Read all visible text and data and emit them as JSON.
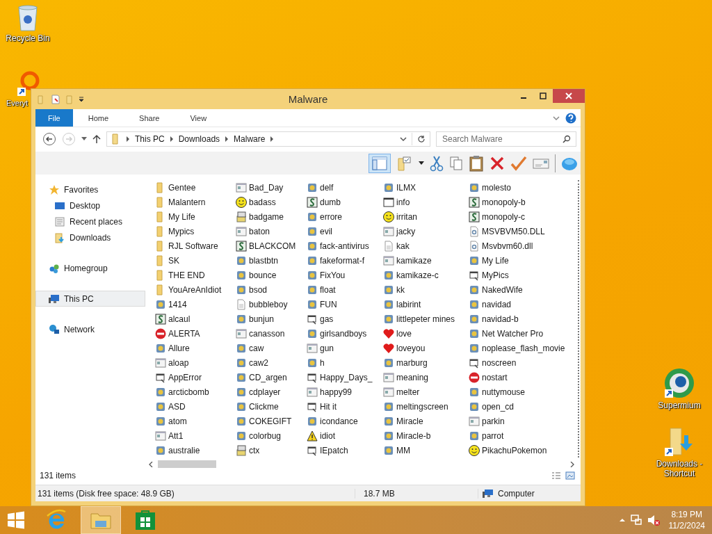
{
  "desktop_icons": [
    {
      "label": "Recycle Bin",
      "kind": "bin"
    },
    {
      "label": "Everyt",
      "kind": "search"
    }
  ],
  "desktop_icons_right": [
    {
      "label": "Supermium",
      "kind": "browser"
    },
    {
      "label": "Downloads - Shortcut",
      "kind": "downloads"
    }
  ],
  "window": {
    "title": "Malware"
  },
  "ribbon_tabs": [
    {
      "label": "File",
      "selected": true
    },
    {
      "label": "Home",
      "selected": false
    },
    {
      "label": "Share",
      "selected": false
    },
    {
      "label": "View",
      "selected": false
    }
  ],
  "breadcrumb": [
    "This PC",
    "Downloads",
    "Malware"
  ],
  "search": {
    "placeholder": "Search Malware"
  },
  "nav": [
    {
      "label": "Favorites",
      "kind": "star",
      "selected": false,
      "children": [
        {
          "label": "Desktop",
          "kind": "desktop",
          "selected": false
        },
        {
          "label": "Recent places",
          "kind": "recent",
          "selected": false
        },
        {
          "label": "Downloads",
          "kind": "downloads",
          "selected": false
        }
      ]
    },
    {
      "label": "Homegroup",
      "kind": "homegroup",
      "selected": false
    },
    {
      "label": "This PC",
      "kind": "pc",
      "selected": true
    },
    {
      "label": "Network",
      "kind": "network",
      "selected": false
    }
  ],
  "files": [
    {
      "name": "Gentee",
      "kind": "folder"
    },
    {
      "name": "Malantern",
      "kind": "folder"
    },
    {
      "name": "My Life",
      "kind": "folder"
    },
    {
      "name": "Mypics",
      "kind": "folder"
    },
    {
      "name": "RJL Software",
      "kind": "folder"
    },
    {
      "name": "SK",
      "kind": "folder"
    },
    {
      "name": "THE END",
      "kind": "folder"
    },
    {
      "name": "YouAreAnIdiot",
      "kind": "folder"
    },
    {
      "name": "1414",
      "kind": "custom"
    },
    {
      "name": "alcaul",
      "kind": "installer"
    },
    {
      "name": "ALERTA",
      "kind": "stop"
    },
    {
      "name": "Allure",
      "kind": "custom"
    },
    {
      "name": "aloap",
      "kind": "program"
    },
    {
      "name": "AppError",
      "kind": "batch"
    },
    {
      "name": "arcticbomb",
      "kind": "custom"
    },
    {
      "name": "ASD",
      "kind": "custom"
    },
    {
      "name": "atom",
      "kind": "custom"
    },
    {
      "name": "Att1",
      "kind": "program"
    },
    {
      "name": "australie",
      "kind": "custom"
    },
    {
      "name": "Bad_Day",
      "kind": "program"
    },
    {
      "name": "badass",
      "kind": "smiley"
    },
    {
      "name": "badgame",
      "kind": "setup"
    },
    {
      "name": "baton",
      "kind": "program"
    },
    {
      "name": "BLACKCOM",
      "kind": "installer"
    },
    {
      "name": "blastbtn",
      "kind": "custom"
    },
    {
      "name": "bounce",
      "kind": "custom"
    },
    {
      "name": "bsod",
      "kind": "custom"
    },
    {
      "name": "bubbleboy",
      "kind": "document"
    },
    {
      "name": "bunjun",
      "kind": "custom"
    },
    {
      "name": "canasson",
      "kind": "program"
    },
    {
      "name": "caw",
      "kind": "custom"
    },
    {
      "name": "caw2",
      "kind": "custom"
    },
    {
      "name": "CD_argen",
      "kind": "custom"
    },
    {
      "name": "cdplayer",
      "kind": "custom"
    },
    {
      "name": "Clickme",
      "kind": "custom"
    },
    {
      "name": "COKEGIFT",
      "kind": "custom"
    },
    {
      "name": "colorbug",
      "kind": "custom"
    },
    {
      "name": "ctx",
      "kind": "setup"
    },
    {
      "name": "delf",
      "kind": "custom"
    },
    {
      "name": "dumb",
      "kind": "installer"
    },
    {
      "name": "errore",
      "kind": "custom"
    },
    {
      "name": "evil",
      "kind": "custom"
    },
    {
      "name": "fack-antivirus",
      "kind": "custom"
    },
    {
      "name": "fakeformat-f",
      "kind": "custom"
    },
    {
      "name": "FixYou",
      "kind": "custom"
    },
    {
      "name": "float",
      "kind": "custom"
    },
    {
      "name": "FUN",
      "kind": "custom"
    },
    {
      "name": "gas",
      "kind": "batch"
    },
    {
      "name": "girlsandboys",
      "kind": "custom"
    },
    {
      "name": "gun",
      "kind": "program"
    },
    {
      "name": "h",
      "kind": "custom"
    },
    {
      "name": "Happy_Days_",
      "kind": "batch"
    },
    {
      "name": "happy99",
      "kind": "program"
    },
    {
      "name": "Hit it",
      "kind": "batch"
    },
    {
      "name": "icondance",
      "kind": "custom"
    },
    {
      "name": "idiot",
      "kind": "warning"
    },
    {
      "name": "IEpatch",
      "kind": "batch"
    },
    {
      "name": "ILMX",
      "kind": "custom"
    },
    {
      "name": "info",
      "kind": "window"
    },
    {
      "name": "irritan",
      "kind": "smiley"
    },
    {
      "name": "jacky",
      "kind": "program"
    },
    {
      "name": "kak",
      "kind": "document"
    },
    {
      "name": "kamikaze",
      "kind": "program"
    },
    {
      "name": "kamikaze-c",
      "kind": "custom"
    },
    {
      "name": "kk",
      "kind": "custom"
    },
    {
      "name": "labirint",
      "kind": "custom"
    },
    {
      "name": "littlepeter mines",
      "kind": "custom"
    },
    {
      "name": "love",
      "kind": "heart"
    },
    {
      "name": "loveyou",
      "kind": "heart"
    },
    {
      "name": "marburg",
      "kind": "custom"
    },
    {
      "name": "meaning",
      "kind": "program"
    },
    {
      "name": "melter",
      "kind": "program"
    },
    {
      "name": "meltingscreen",
      "kind": "custom"
    },
    {
      "name": "Miracle",
      "kind": "custom"
    },
    {
      "name": "Miracle-b",
      "kind": "custom"
    },
    {
      "name": "MM",
      "kind": "custom"
    },
    {
      "name": "molesto",
      "kind": "custom"
    },
    {
      "name": "monopoly-b",
      "kind": "installer"
    },
    {
      "name": "monopoly-c",
      "kind": "installer"
    },
    {
      "name": "MSVBVM50.DLL",
      "kind": "dll"
    },
    {
      "name": "Msvbvm60.dll",
      "kind": "dll"
    },
    {
      "name": "My Life",
      "kind": "custom"
    },
    {
      "name": "MyPics",
      "kind": "batch"
    },
    {
      "name": "NakedWife",
      "kind": "custom"
    },
    {
      "name": "navidad",
      "kind": "custom"
    },
    {
      "name": "navidad-b",
      "kind": "custom"
    },
    {
      "name": "Net Watcher Pro",
      "kind": "custom"
    },
    {
      "name": "noplease_flash_movie",
      "kind": "custom"
    },
    {
      "name": "noscreen",
      "kind": "batch"
    },
    {
      "name": "nostart",
      "kind": "stop"
    },
    {
      "name": "nuttymouse",
      "kind": "custom"
    },
    {
      "name": "open_cd",
      "kind": "custom"
    },
    {
      "name": "parkin",
      "kind": "program"
    },
    {
      "name": "parrot",
      "kind": "custom"
    },
    {
      "name": "PikachuPokemon",
      "kind": "smiley"
    }
  ],
  "item_count": "131 items",
  "status_bar": {
    "summary": "131 items (Disk free space: 48.9 GB)",
    "size": "18.7 MB",
    "location": "Computer"
  },
  "taskbar": {
    "apps": [
      {
        "kind": "ie",
        "selected": false
      },
      {
        "kind": "explorer",
        "selected": true
      },
      {
        "kind": "store",
        "selected": false
      }
    ],
    "time": "8:19 PM",
    "date": "11/2/2024"
  }
}
